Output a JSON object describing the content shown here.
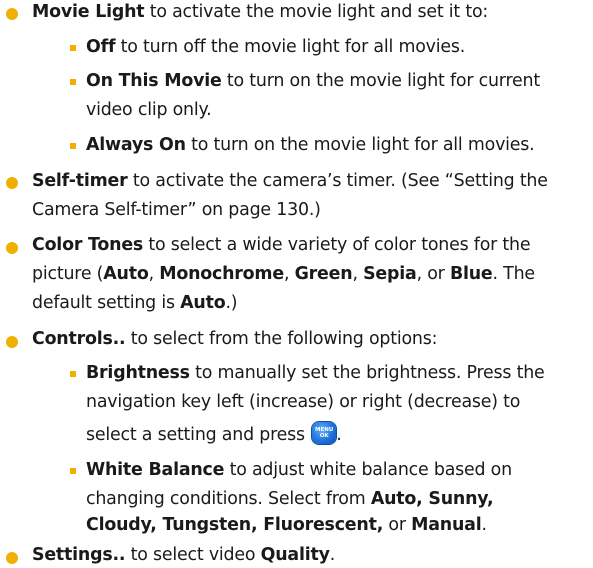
{
  "items": [
    {
      "bold": "Movie Light",
      "rest": " to activate the movie light and set it to:"
    },
    {
      "bold": "Off",
      "rest": " to turn off the movie light for all movies."
    },
    {
      "bold": "On This Movie",
      "rest": " to turn on the movie light for current",
      "line2": "video clip only."
    },
    {
      "bold": "Always On",
      "rest": " to turn on the movie light for all movies."
    },
    {
      "bold": "Self-timer",
      "rest": " to activate the camera’s timer. (See “Setting the",
      "line2": "Camera Self-timer” on page 130.)"
    },
    {
      "bold": "Color Tones",
      "rest": " to select a wide variety of color tones for the",
      "line2_a": "picture (",
      "line2_b1": "Auto",
      "line2_c1": ", ",
      "line2_b2": "Monochrome",
      "line2_c2": ", ",
      "line2_b3": "Green",
      "line2_c3": ", ",
      "line2_b4": "Sepia",
      "line2_c4": ", or ",
      "line2_b5": "Blue",
      "line2_c5": ". The",
      "line3_a": "default setting is ",
      "line3_b": "Auto",
      "line3_c": ".)"
    },
    {
      "bold": "Controls..",
      "rest": " to select from the following options:"
    },
    {
      "bold": "Brightness",
      "rest": " to manually set the brightness. Press the",
      "line2": "navigation key left (increase) or right (decrease) to",
      "line3": "select a setting and press",
      "line3_end": "."
    },
    {
      "bold": "White Balance",
      "rest": " to adjust white balance based on",
      "line2": "changing conditions. Select from ",
      "line3_b1": "Auto, Sunny,",
      "line3_b2": "Cloudy, Tungsten, Fluorescent,",
      "line3_c": " or ",
      "line3_b3": "Manual",
      "line3_d": "."
    },
    {
      "bold": "Settings..",
      "rest": " to select video ",
      "bold2": "Quality",
      "end": "."
    }
  ],
  "menu_key": {
    "top": "MENU",
    "bottom": "OK"
  },
  "colors": {
    "bullet": "#f0b000",
    "text": "#1a1a1a",
    "key": "#1e6fd6"
  }
}
